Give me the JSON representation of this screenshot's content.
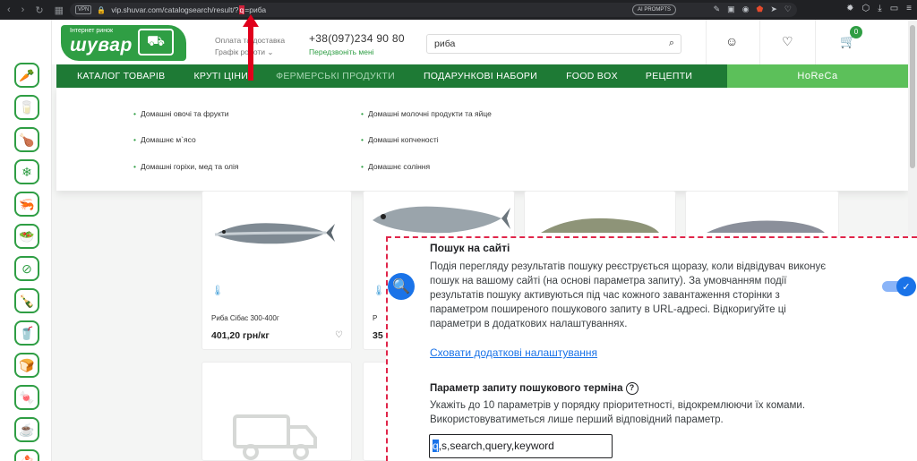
{
  "browser": {
    "vpn_label": "VPN",
    "url_prefix": "vip.shuvar.com/catalogsearch/result/?",
    "url_mark": "q",
    "url_suffix": "=риба",
    "ai_prompts": "AI PROMPTS"
  },
  "header": {
    "logo_small": "Інтернет ринок",
    "logo_big": "шувар",
    "payment_label": "Оплата та доставка",
    "schedule_label": "Графік роботи",
    "phone": "+38(097)234 90 80",
    "callback": "Передзвоніть мені",
    "search_value": "риба",
    "cart_count": "0"
  },
  "nav": {
    "items": [
      "КАТАЛОГ ТОВАРІВ",
      "КРУТІ ЦІНИ",
      "ФЕРМЕРСЬКІ ПРОДУКТИ",
      "ПОДАРУНКОВІ НАБОРИ",
      "FOOD BOX",
      "РЕЦЕПТИ"
    ],
    "horeca": "HoReCa"
  },
  "dropdown": {
    "col1": [
      "Домашні овочі та фрукти",
      "Домашнє м`ясо",
      "Домашні горіхи, мед та олія"
    ],
    "col2": [
      "Домашні молочні продукти та яйце",
      "Домашні копченості",
      "Домашнє соління"
    ]
  },
  "products": [
    {
      "name": "Риба Сібас 300-400г",
      "price": "401,20 грн/кг"
    },
    {
      "name": "Р",
      "price": "35"
    }
  ],
  "panel": {
    "title": "Пошук на сайті",
    "description": "Подія перегляду результатів пошуку реєструється щоразу, коли відвідувач виконує пошук на вашому сайті (на основі параметра запиту). За умовчанням події результатів пошуку активуються під час кожного завантаження сторінки з параметром поширеного пошукового запиту в URL-адресі. Відкоригуйте ці параметри в додаткових налаштуваннях.",
    "link": "Сховати додаткові налаштування",
    "param_title": "Параметр запиту пошукового терміна",
    "param_desc": "Укажіть до 10 параметрів у порядку пріоритетності, відокремлюючи їх комами. Використовуватиметься лише перший відповідний параметр.",
    "input_first": "q",
    "input_rest": ",s,search,query,keyword"
  },
  "colors": {
    "brand_green": "#2f9e44",
    "nav_green": "#1e7a35",
    "horeca_green": "#5cc05a",
    "accent_blue": "#1a73e8",
    "annotation_red": "#e0264a"
  }
}
